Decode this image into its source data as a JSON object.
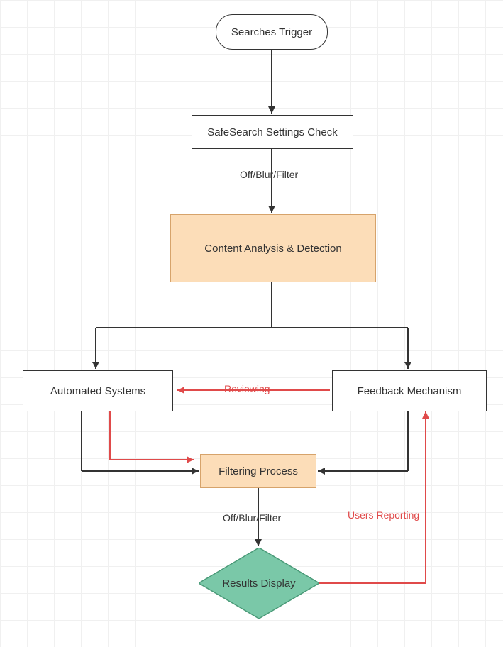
{
  "nodes": {
    "trigger": {
      "label": "Searches Trigger"
    },
    "settings_check": {
      "label": "SafeSearch Settings Check"
    },
    "content_analysis": {
      "label": "Content Analysis & Detection"
    },
    "automated_systems": {
      "label": "Automated Systems"
    },
    "feedback_mechanism": {
      "label": "Feedback Mechanism"
    },
    "filtering_process": {
      "label": "Filtering Process"
    },
    "results_display": {
      "label": "Results Display"
    }
  },
  "edge_labels": {
    "after_settings": "Off/Blur/Filter",
    "after_filtering": "Off/Blur/Filter",
    "reviewing": "Reviewing",
    "users_reporting": "Users Reporting"
  },
  "chart_data": {
    "type": "flowchart",
    "nodes": [
      {
        "id": "trigger",
        "type": "terminator",
        "label": "Searches Trigger"
      },
      {
        "id": "settings_check",
        "type": "process",
        "label": "SafeSearch Settings Check"
      },
      {
        "id": "content_analysis",
        "type": "process",
        "label": "Content Analysis & Detection",
        "fill": "#fcddb8"
      },
      {
        "id": "automated_systems",
        "type": "process",
        "label": "Automated Systems"
      },
      {
        "id": "feedback_mechanism",
        "type": "process",
        "label": "Feedback Mechanism"
      },
      {
        "id": "filtering_process",
        "type": "process",
        "label": "Filtering Process",
        "fill": "#fcddb8"
      },
      {
        "id": "results_display",
        "type": "decision",
        "label": "Results Display",
        "fill": "#7ac8a8"
      }
    ],
    "edges": [
      {
        "from": "trigger",
        "to": "settings_check"
      },
      {
        "from": "settings_check",
        "to": "content_analysis",
        "label": "Off/Blur/Filter"
      },
      {
        "from": "content_analysis",
        "to": "automated_systems"
      },
      {
        "from": "content_analysis",
        "to": "feedback_mechanism"
      },
      {
        "from": "automated_systems",
        "to": "filtering_process"
      },
      {
        "from": "feedback_mechanism",
        "to": "filtering_process"
      },
      {
        "from": "automated_systems",
        "to": "filtering_process",
        "color": "#e04a4a"
      },
      {
        "from": "feedback_mechanism",
        "to": "automated_systems",
        "label": "Reviewing",
        "color": "#e04a4a"
      },
      {
        "from": "filtering_process",
        "to": "results_display",
        "label": "Off/Blur/Filter"
      },
      {
        "from": "results_display",
        "to": "feedback_mechanism",
        "label": "Users Reporting",
        "color": "#e04a4a"
      }
    ]
  }
}
